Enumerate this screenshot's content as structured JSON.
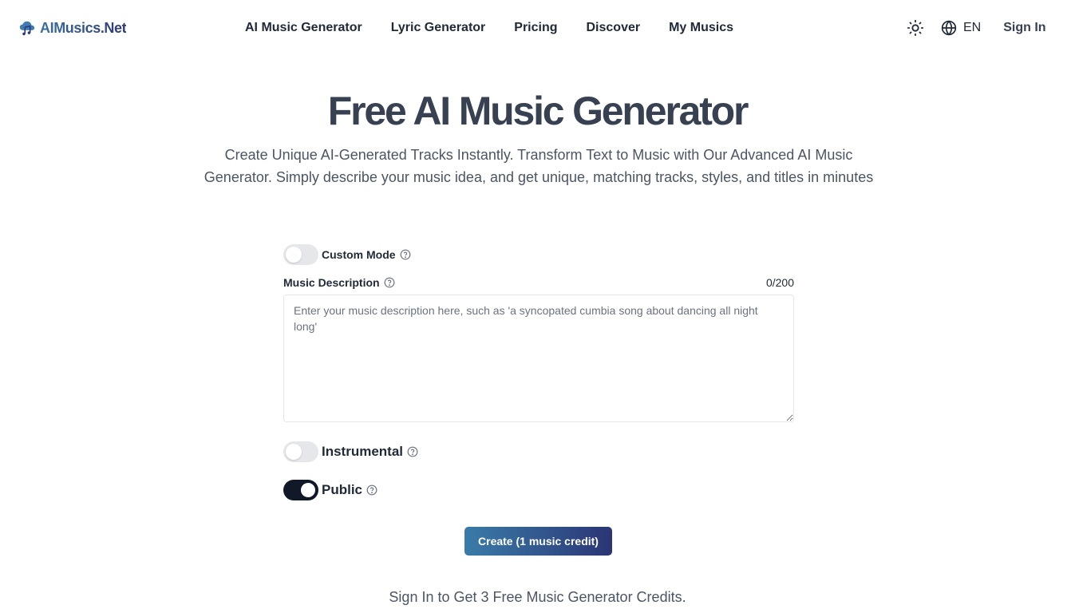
{
  "brand": {
    "name": "AIMusics.Net",
    "logo_icon": "cloud-music-note-icon"
  },
  "nav": {
    "items": [
      {
        "label": "AI Music Generator"
      },
      {
        "label": "Lyric Generator"
      },
      {
        "label": "Pricing"
      },
      {
        "label": "Discover"
      },
      {
        "label": "My Musics"
      }
    ]
  },
  "header_actions": {
    "theme_icon": "sun-icon",
    "language_icon": "globe-icon",
    "language": "EN",
    "sign_in": "Sign In"
  },
  "hero": {
    "title": "Free AI Music Generator",
    "subtitle": "Create Unique AI-Generated Tracks Instantly. Transform Text to Music with Our Advanced AI Music Generator. Simply describe your music idea, and get unique, matching tracks, styles, and titles in minutes"
  },
  "form": {
    "custom_mode": {
      "label": "Custom Mode",
      "enabled": false
    },
    "description": {
      "label": "Music Description",
      "counter": "0/200",
      "value": "",
      "placeholder": "Enter your music description here, such as 'a syncopated cumbia song about dancing all night long'"
    },
    "instrumental": {
      "label": "Instrumental",
      "enabled": false
    },
    "public": {
      "label": "Public",
      "enabled": true
    },
    "help_icon": "question-circle-icon"
  },
  "create_button": {
    "label": "Create (1 music credit)"
  },
  "footer_note": "Sign In to Get 3 Free Music Generator Credits.",
  "colors": {
    "brand_gradient_start": "#3a7ca8",
    "brand_gradient_end": "#2b3575",
    "toggle_on": "#111827",
    "toggle_off": "#e5e7eb",
    "title": "#374151"
  }
}
